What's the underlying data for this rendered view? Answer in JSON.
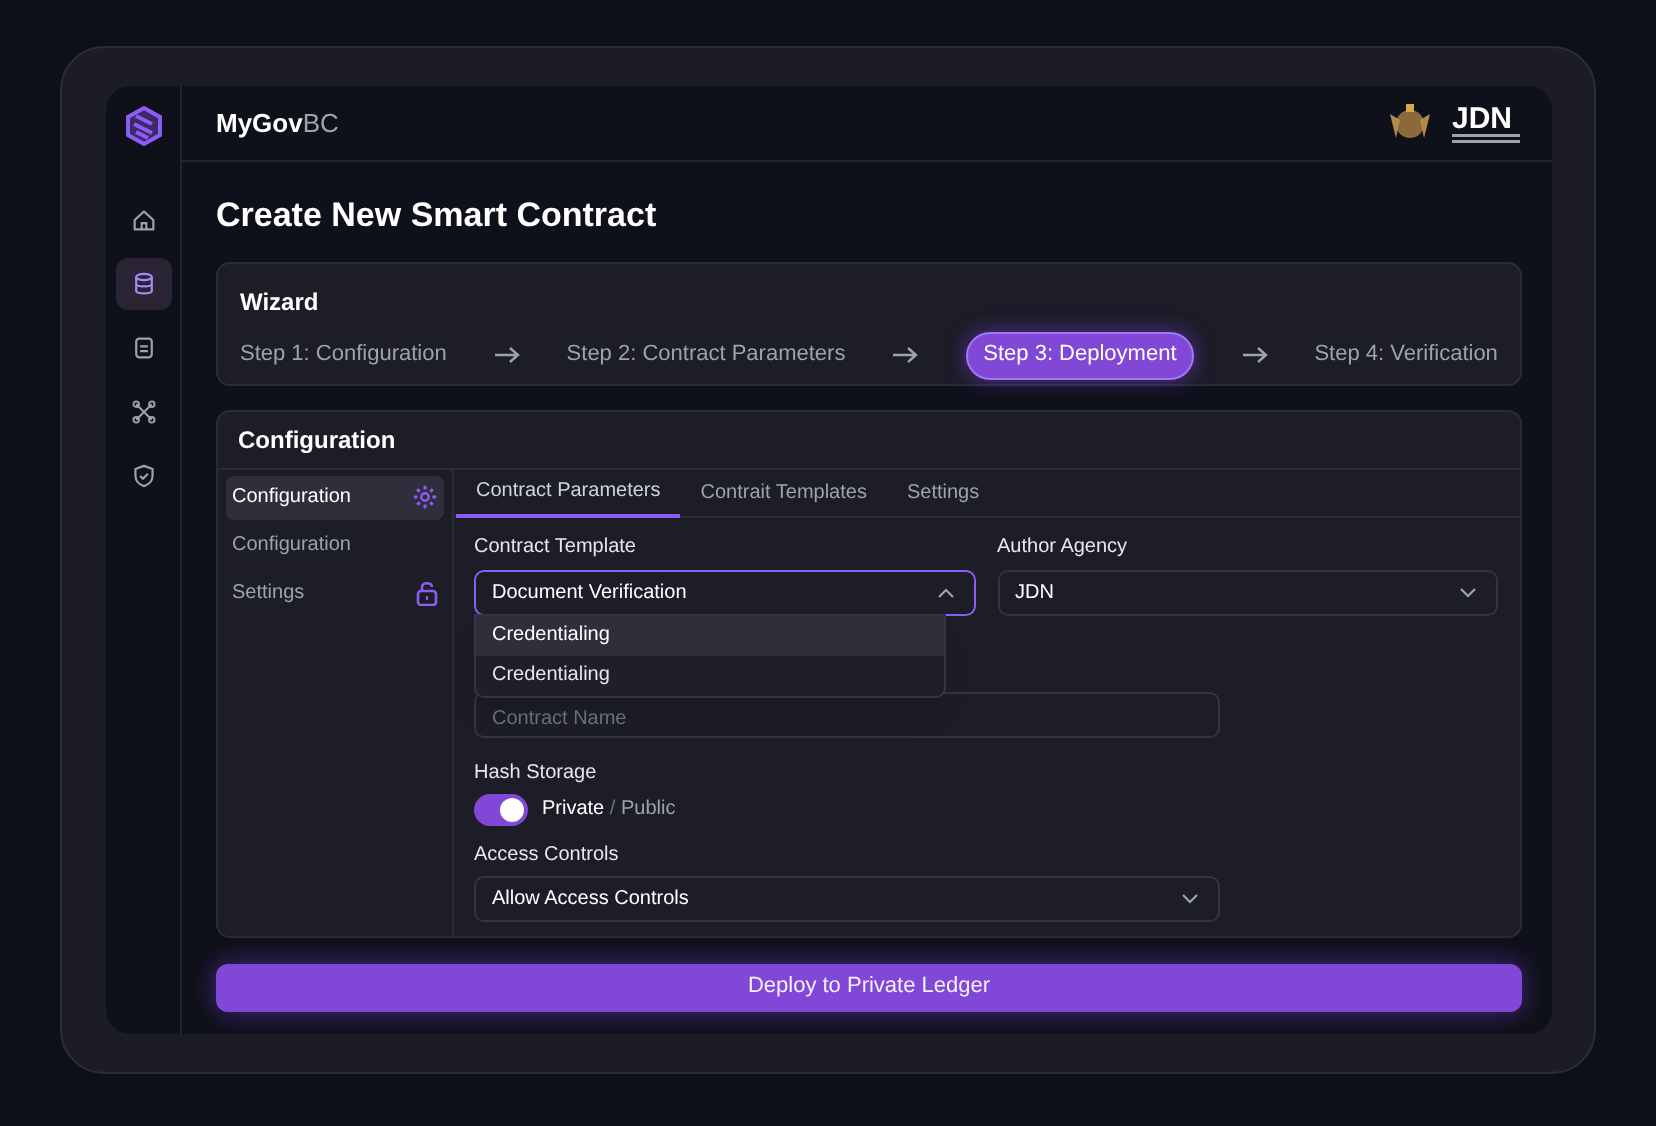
{
  "brand": {
    "name_main": "MyGov",
    "name_accent": "BC"
  },
  "header": {
    "logo_text": "JDN"
  },
  "sidebar_icons": [
    {
      "kind": "home",
      "selected": false
    },
    {
      "kind": "database",
      "selected": true
    },
    {
      "kind": "document",
      "selected": false
    },
    {
      "kind": "network",
      "selected": false
    },
    {
      "kind": "shield",
      "selected": false
    }
  ],
  "page_title": "Create New Smart Contract",
  "wizard": {
    "title": "Wizard",
    "steps": [
      {
        "label": "Step 1: Configuration",
        "selected": false
      },
      {
        "label": "Step 2: Contract Parameters",
        "selected": false
      },
      {
        "label": "Step 3: Deployment",
        "selected": true
      },
      {
        "label": "Step 4: Verification",
        "selected": false
      }
    ]
  },
  "configuration": {
    "title": "Configuration",
    "nav": [
      {
        "label": "Configuration",
        "selected": true,
        "kind": "gear"
      },
      {
        "label": "Configuration",
        "selected": false,
        "kind": "plain"
      },
      {
        "label": "Settings",
        "selected": false,
        "kind": "lock"
      }
    ],
    "tabs": [
      {
        "label": "Contract Parameters",
        "selected": true
      },
      {
        "label": "Contrait Templates",
        "selected": false
      },
      {
        "label": "Settings",
        "selected": false
      }
    ],
    "contract_template": {
      "label": "Contract Template",
      "value": "Document Verification",
      "expanded": true,
      "options": [
        {
          "label": "Credentialing",
          "selected": true
        },
        {
          "label": "Credentialing",
          "selected": false
        }
      ]
    },
    "author_agency": {
      "label": "Author Agency",
      "value": "JDN",
      "expanded": false
    },
    "contract_name": {
      "placeholder": "Contract Name"
    },
    "hash_storage": {
      "label": "Hash Storage",
      "on": true,
      "on_label": "Private",
      "separator": "/",
      "off_label": "Public"
    },
    "access_controls": {
      "label": "Access Controls",
      "value": "Allow Access Controls",
      "expanded": false
    }
  },
  "deploy_button": "Deploy to Private Ledger"
}
